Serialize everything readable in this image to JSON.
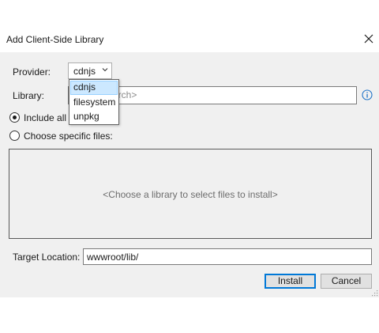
{
  "dialog": {
    "title": "Add Client-Side Library",
    "close_icon": "close-icon"
  },
  "provider": {
    "label": "Provider:",
    "selected": "cdnjs",
    "options": [
      "cdnjs",
      "filesystem",
      "unpkg"
    ],
    "highlighted_option": "cdnjs"
  },
  "library": {
    "label": "Library:",
    "placeholder_visible": "arch>",
    "info_icon": "info-icon"
  },
  "files": {
    "include_all_label": "Include all",
    "include_all_checked": true,
    "choose_specific_label": "Choose specific files:",
    "choose_specific_checked": false,
    "empty_message": "<Choose a library to select files to install>"
  },
  "target": {
    "label": "Target Location:",
    "value": "wwwroot/lib/"
  },
  "buttons": {
    "install": "Install",
    "cancel": "Cancel"
  },
  "colors": {
    "accent": "#0078d7",
    "selection_bg": "#cce8ff",
    "dialog_bg": "#f0f0f0"
  }
}
